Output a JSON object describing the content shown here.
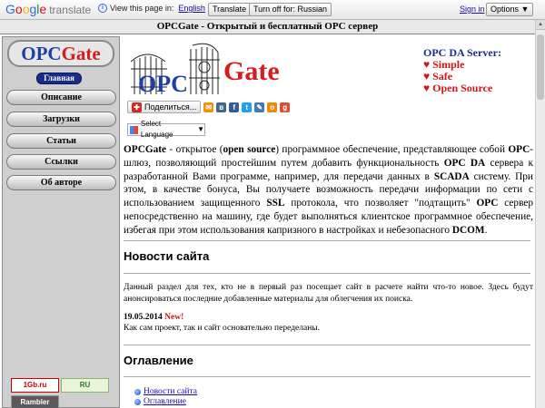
{
  "translate_bar": {
    "logo_google": "Google",
    "logo_translate": "translate",
    "view_page_in": "View this page in:",
    "language": "English",
    "translate_button": "Translate",
    "turn_off_button": "Turn off for: Russian",
    "sign_in": "Sign in",
    "options": "Options ▼"
  },
  "page": {
    "header_title": "OPCGate - Открытый и бесплатный OPC сервер"
  },
  "sidebar": {
    "brand_opc": "OPC",
    "brand_gate": "Gate",
    "active_item": "Главная",
    "items": [
      "Описание",
      "Загрузки",
      "Статьи",
      "Ссылки",
      "Об авторе"
    ],
    "counters": [
      "1Gb.ru",
      "RU",
      "Rambler"
    ]
  },
  "logo": {
    "opc": "OPC",
    "gate": "Gate"
  },
  "opc_da": {
    "title": "OPC DA Server:",
    "features": [
      "♥ Simple",
      "♥ Safe",
      "♥ Open Source"
    ]
  },
  "share": {
    "share_label": "Поделиться...",
    "select_language": "Select Language"
  },
  "intro": {
    "p1": "OPCGate",
    "p2": " - открытое (",
    "p3": "open source",
    "p4": ") программное обеспечение, представляющее собой ",
    "p5": "OPC",
    "p6": "-шлюз, позволяющий простейшим путем добавить функциональность ",
    "p7": "OPC DA",
    "p8": "  сервера к разработанной Вами программе, например, для передачи данных в ",
    "p9": "SCADA",
    "p10": "  систему. При этом, в качестве бонуса, Вы получаете возможность передачи информации по сети с использованием защищенного ",
    "p11": "SSL",
    "p12": " протокола, что позволяет \"подтащить\" ",
    "p13": "OPC",
    "p14": " сервер непосредственно на машину, где будет выполняться клиентское программное обеспечение, избегая при этом использования капризного в настройках и небезопасного ",
    "p15": "DCOM",
    "p16": "."
  },
  "news": {
    "heading": "Новости сайта",
    "description": "Данный раздел для тех, кто не в первый раз посещает сайт в расчете найти что-то новое. Здесь будут анонсироваться последние добавленные материалы для облегчения их поиска.",
    "date": "19.05.2014",
    "new_label": "New!",
    "item_text": "Как сам проект, так и сайт основательно переделаны."
  },
  "toc": {
    "heading": "Оглавление",
    "items": [
      "Новости сайта",
      "Оглавление"
    ]
  }
}
